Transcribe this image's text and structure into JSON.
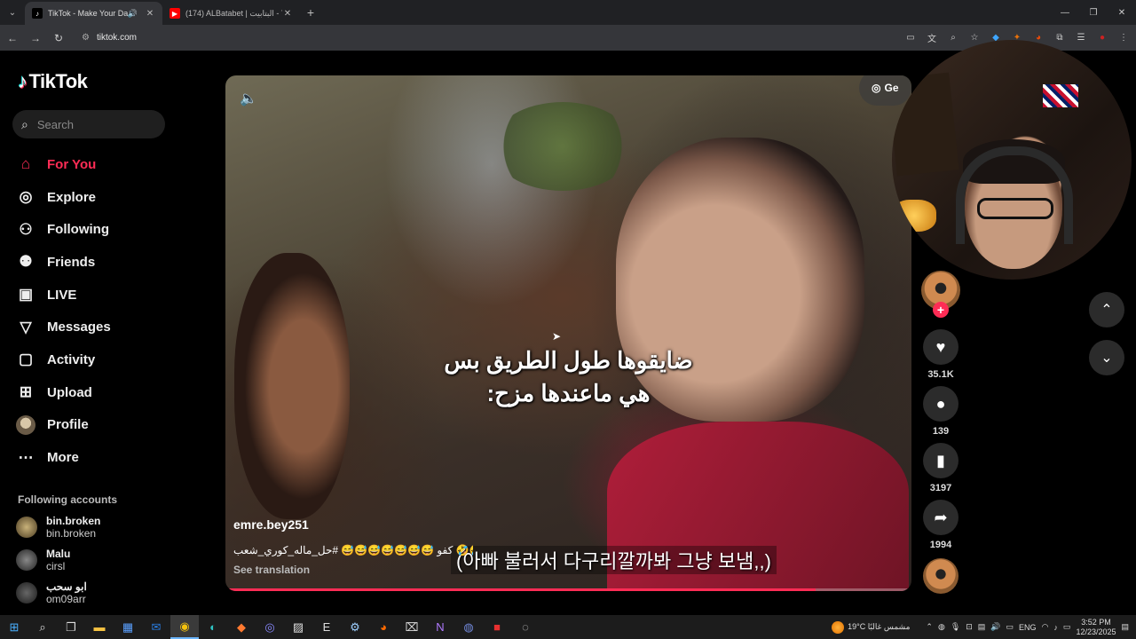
{
  "browser": {
    "tabs": [
      {
        "title": "TikTok - Make Your Day",
        "active": true,
        "audio": true
      },
      {
        "title": "(174) ALBatabet | البتابيت - YouTube",
        "active": false,
        "audio": false
      }
    ],
    "url": "tiktok.com"
  },
  "sidebar": {
    "logo": "TikTok",
    "search_placeholder": "Search",
    "nav": [
      {
        "label": "For You",
        "icon": "home-icon",
        "active": true
      },
      {
        "label": "Explore",
        "icon": "compass-icon"
      },
      {
        "label": "Following",
        "icon": "person-add-icon"
      },
      {
        "label": "Friends",
        "icon": "friends-icon"
      },
      {
        "label": "LIVE",
        "icon": "live-tv-icon"
      },
      {
        "label": "Messages",
        "icon": "send-icon"
      },
      {
        "label": "Activity",
        "icon": "activity-icon"
      },
      {
        "label": "Upload",
        "icon": "upload-icon"
      },
      {
        "label": "Profile",
        "icon": "avatar"
      },
      {
        "label": "More",
        "icon": "more-icon"
      }
    ],
    "following_title": "Following accounts",
    "accounts": [
      {
        "name": "bin.broken",
        "handle": "bin.broken"
      },
      {
        "name": "Malu",
        "handle": "cirsl"
      },
      {
        "name": "ابو سحب",
        "handle": "om09arr"
      }
    ]
  },
  "video": {
    "get_app": "Ge",
    "subtitle_ar_line1": "ضايقوها طول الطريق بس",
    "subtitle_ar_line2": "هي ماعندها مزح:",
    "subtitle_ko": "(아빠 불러서 다구리깔까봐 그냥 보냄,,)",
    "author": "emre.bey251",
    "caption": "كفو 😅😅😅😅😅😅😅 #حل_ماله_كوري_شعب 🤣🤣",
    "see_translation": "See translation",
    "progress": 0.86
  },
  "actions": {
    "likes": "35.1K",
    "comments": "139",
    "saves": "3197",
    "shares": "1994"
  },
  "taskbar": {
    "weather": "19°C مشمس غالبًا",
    "lang": "ENG",
    "time": "3:52 PM",
    "date": "12/23/2025"
  },
  "colors": {
    "accent": "#fe2c55",
    "background": "#000000"
  }
}
